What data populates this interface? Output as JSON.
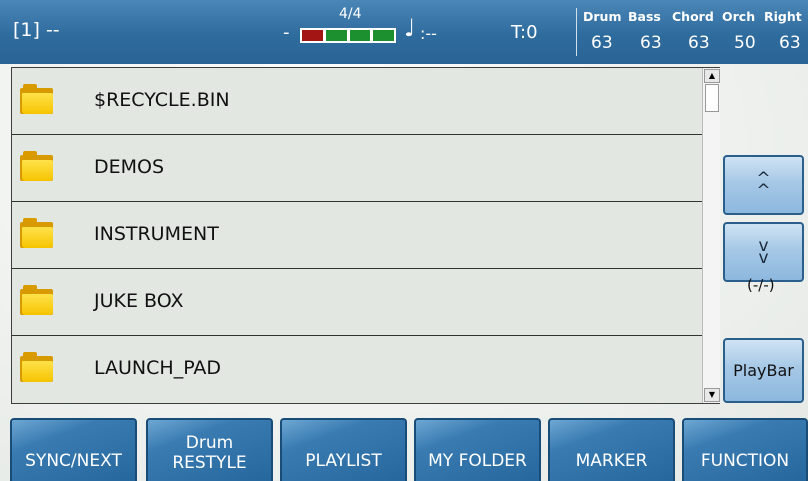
{
  "status_bar": {
    "song_slot": "[1] --",
    "tempo_dash": "-",
    "time_signature": "4/4",
    "beat_meter": {
      "beats": 4,
      "active_beat": 1,
      "colors": {
        "active": "#a31414",
        "inactive": "#1c8f2e"
      }
    },
    "note_value": ":--",
    "transpose": "T:0",
    "volumes": [
      {
        "label": "Drum",
        "value": "63"
      },
      {
        "label": "Bass",
        "value": "63"
      },
      {
        "label": "Chord",
        "value": "63"
      },
      {
        "label": "Orch",
        "value": "50"
      },
      {
        "label": "Right",
        "value": "63"
      }
    ]
  },
  "file_list": {
    "items": [
      {
        "name": "$RECYCLE.BIN",
        "icon": "folder-icon"
      },
      {
        "name": "DEMOS",
        "icon": "folder-icon"
      },
      {
        "name": "INSTRUMENT",
        "icon": "folder-icon"
      },
      {
        "name": "JUKE BOX",
        "icon": "folder-icon"
      },
      {
        "name": "LAUNCH_PAD",
        "icon": "folder-icon"
      }
    ]
  },
  "side_panel": {
    "page_up_icon": "double-chevron-up-icon",
    "page_down_icon": "double-chevron-down-icon",
    "page_info": "(-/-)",
    "playbar_label": "PlayBar"
  },
  "bottom_buttons": [
    {
      "label": "SYNC/NEXT"
    },
    {
      "label_top": "Drum",
      "label": "RESTYLE"
    },
    {
      "label": "PLAYLIST"
    },
    {
      "label": "MY FOLDER"
    },
    {
      "label": "MARKER"
    },
    {
      "label": "FUNCTION"
    }
  ],
  "colors": {
    "topbar": "#2f6c9e",
    "list_row": "#e2e7e1",
    "button_blue": "#26679e",
    "side_button": "#a6c8e6"
  }
}
